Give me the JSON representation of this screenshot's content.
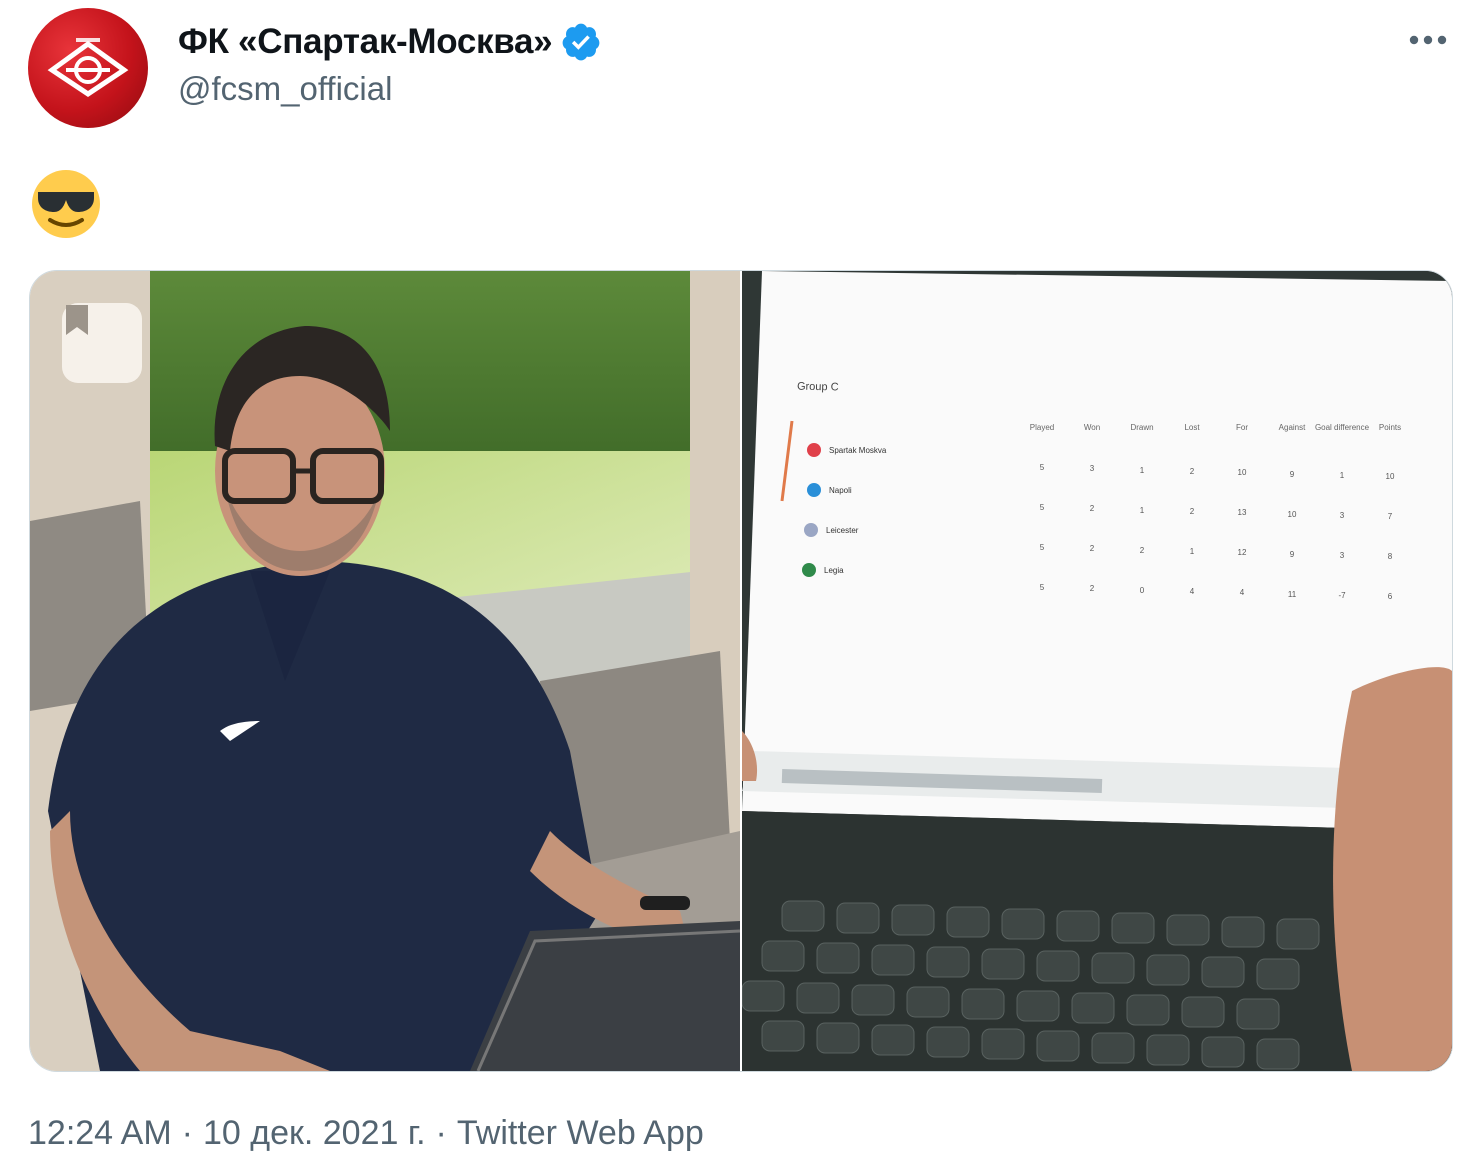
{
  "tweet": {
    "author": {
      "display_name": "ФК «Спартак-Москва»",
      "handle": "@fcsm_official",
      "verified": true,
      "avatar_icon": "spartak-logo-icon"
    },
    "text_emoji": "smiling-face-with-sunglasses-icon",
    "meta": {
      "time": "12:24 AM",
      "date": "10 дек. 2021 г.",
      "source": "Twitter Web App",
      "separator": "·"
    },
    "media": {
      "left_photo": "man-with-laptop-photo",
      "right_photo": "laptop-screen-standings-photo"
    },
    "more_icon": "more-options-icon",
    "bookmark_icon": "bookmark-icon"
  },
  "colors": {
    "verified_blue": "#1d9bf0",
    "secondary_text": "#536471",
    "spartak_red": "#c4131b"
  },
  "standings": {
    "title": "Group C",
    "headers": [
      "Played",
      "Won",
      "Drawn",
      "Lost",
      "For",
      "Against",
      "Goal difference",
      "Points"
    ],
    "teams": [
      {
        "name": "Spartak Moskva",
        "cells": [
          "5",
          "3",
          "1",
          "2",
          "10",
          "9",
          "1",
          "10"
        ]
      },
      {
        "name": "Napoli",
        "cells": [
          "5",
          "2",
          "1",
          "2",
          "13",
          "10",
          "3",
          "7"
        ]
      },
      {
        "name": "Leicester",
        "cells": [
          "5",
          "2",
          "2",
          "1",
          "12",
          "9",
          "3",
          "8"
        ]
      },
      {
        "name": "Legia",
        "cells": [
          "5",
          "2",
          "0",
          "4",
          "4",
          "11",
          "-7",
          "6"
        ]
      }
    ]
  }
}
